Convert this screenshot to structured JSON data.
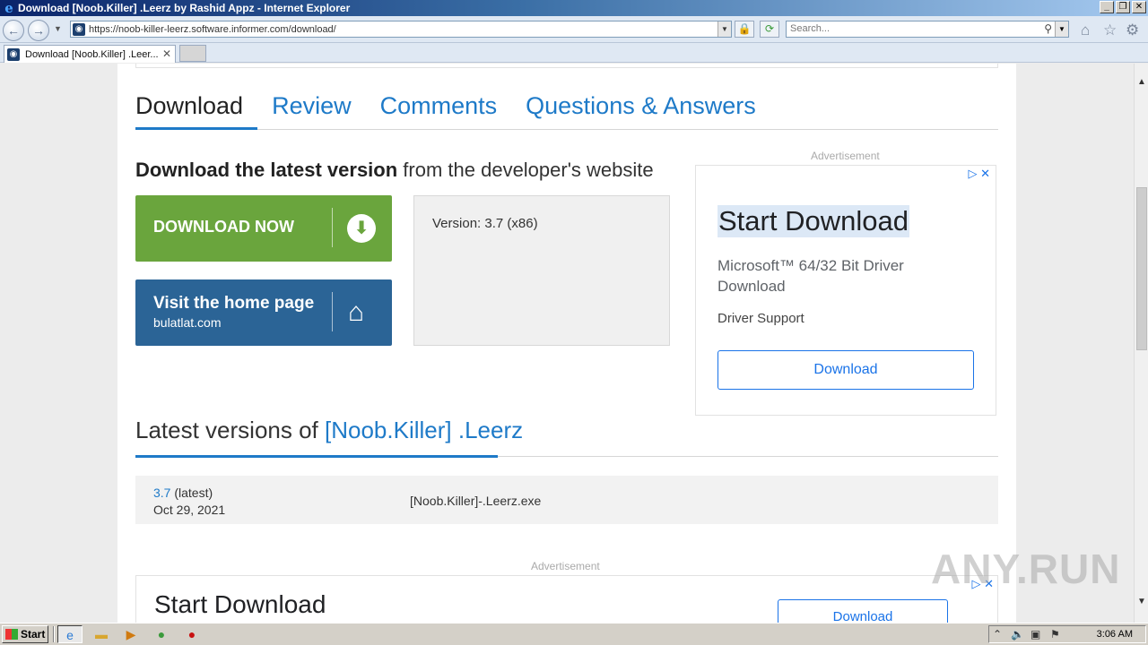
{
  "window": {
    "title": "Download [Noob.Killer] .Leerz by Rashid Appz - Internet Explorer",
    "controls": [
      "_",
      "❐",
      "✕"
    ]
  },
  "addressbar": {
    "url": "https://noob-killer-leerz.software.informer.com/download/",
    "search_placeholder": "Search..."
  },
  "tabs": [
    {
      "label": "Download [Noob.Killer] .Leer..."
    }
  ],
  "page": {
    "nav_tabs": [
      "Download",
      "Review",
      "Comments",
      "Questions & Answers"
    ],
    "dl_heading_bold": "Download the latest version",
    "dl_heading_rest": " from the developer's website",
    "download_now_label": "DOWNLOAD NOW",
    "home_label": "Visit the home page",
    "home_domain": "bulatlat.com",
    "version_label": "Version: ",
    "version_value": "3.7 (x86)",
    "ad_label": "Advertisement",
    "ad": {
      "title": "Start Download",
      "description": "Microsoft™ 64/32 Bit Driver Download",
      "sub": "Driver Support",
      "button": "Download"
    },
    "latest_heading_prefix": "Latest versions of ",
    "latest_heading_name": "[Noob.Killer] .Leerz",
    "versions": [
      {
        "version": "3.7",
        "tag": " (latest)",
        "date": "Oct 29, 2021",
        "file": "[Noob.Killer]-.Leerz.exe"
      }
    ],
    "ad2": {
      "title": "Start Download",
      "button": "Download"
    }
  },
  "watermark": "ANY.RUN",
  "taskbar": {
    "start_label": "Start",
    "clock": "3:06 AM"
  },
  "colors": {
    "accent_blue": "#1e7ac8",
    "download_green": "#6aa53d",
    "home_blue": "#2b6496",
    "ad_blue": "#1a73e8"
  }
}
